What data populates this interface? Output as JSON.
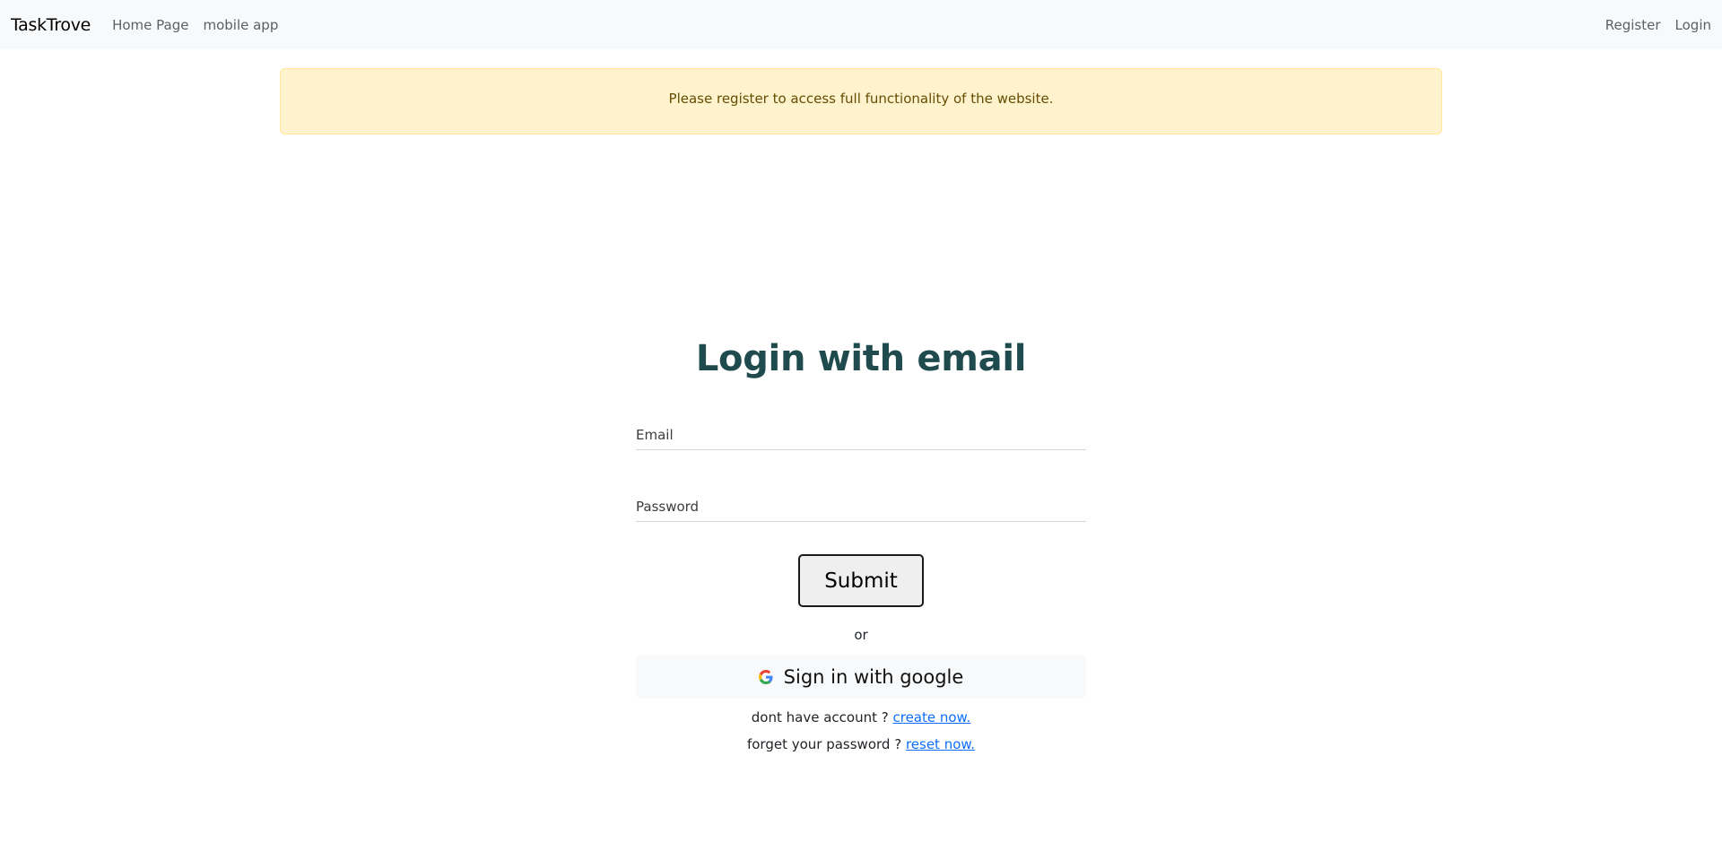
{
  "navbar": {
    "brand": "TaskTrove",
    "left_links": [
      "Home Page",
      "mobile app"
    ],
    "right_links": [
      "Register",
      "Login"
    ]
  },
  "alert": {
    "message": "Please register to access full functionality of the website."
  },
  "login": {
    "title": "Login with email",
    "email_placeholder": "Email",
    "password_placeholder": "Password",
    "submit_label": "Submit",
    "or_text": "or",
    "google_label": "Sign in with google",
    "no_account_text": "dont have account ?",
    "create_link": "create now.",
    "forgot_text": "forget your password ?",
    "reset_link": "reset now."
  },
  "colors": {
    "title": "#1f4b4e",
    "link": "#0d6efd",
    "alert_bg": "#fff3cd",
    "navbar_bg": "#f8f9fa"
  },
  "icons": {
    "google": "google-g-icon"
  }
}
